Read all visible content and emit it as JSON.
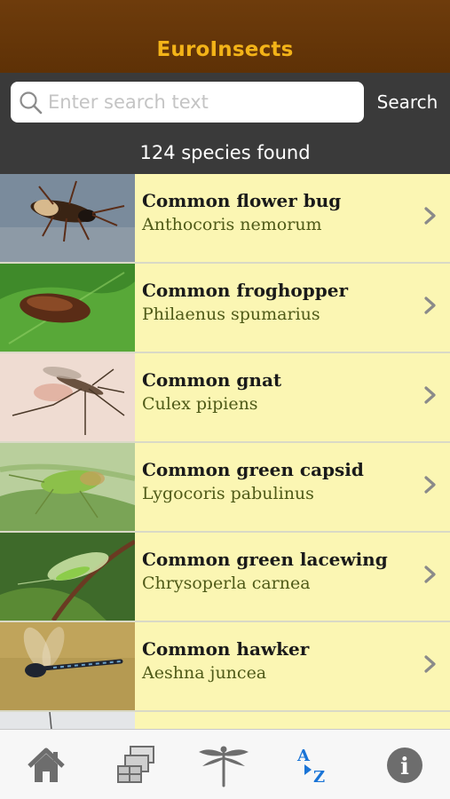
{
  "app": {
    "title": "EuroInsects"
  },
  "search": {
    "placeholder": "Enter search text",
    "value": "",
    "button_label": "Search"
  },
  "result_count": "124 species found",
  "species": [
    {
      "common": "Common flower bug",
      "latin": "Anthocoris nemorum"
    },
    {
      "common": "Common froghopper",
      "latin": "Philaenus spumarius"
    },
    {
      "common": "Common gnat",
      "latin": "Culex pipiens"
    },
    {
      "common": "Common green capsid",
      "latin": "Lygocoris pabulinus"
    },
    {
      "common": "Common green lacewing",
      "latin": "Chrysoperla carnea"
    },
    {
      "common": "Common hawker",
      "latin": "Aeshna juncea"
    },
    {
      "common": "",
      "latin": ""
    }
  ],
  "tabbar": {
    "items": [
      {
        "name": "home",
        "icon": "home-icon"
      },
      {
        "name": "groups",
        "icon": "groups-icon"
      },
      {
        "name": "insect",
        "icon": "dragonfly-icon"
      },
      {
        "name": "a-z",
        "icon": "az-sort-icon",
        "active": true,
        "glyph_a": "A",
        "glyph_z": "Z"
      },
      {
        "name": "info",
        "icon": "info-icon",
        "glyph": "i"
      }
    ]
  },
  "colors": {
    "header_bg": "#6e3c0c",
    "title": "#f3b318",
    "searchbar_bg": "#3a3a3a",
    "row_bg": "#fbf6b3",
    "latin_text": "#4f5a18",
    "tab_active": "#1a74d6",
    "tab_inactive": "#6d6d6d"
  }
}
